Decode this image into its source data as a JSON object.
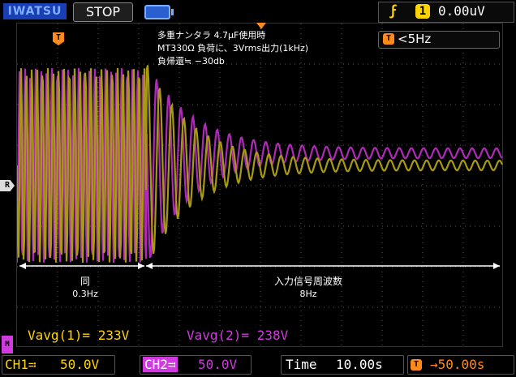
{
  "header": {
    "brand": "IWATSU",
    "run_state": "STOP",
    "trigger_edge_icon": "rising-edge-icon",
    "trigger_channel": "1",
    "trigger_level": "0.00uV"
  },
  "screen": {
    "trigger_marker": "T",
    "reference_marker": "R",
    "ch2_marker": "M",
    "freq_counter_icon": "T",
    "freq_counter": "<5Hz",
    "annotation": {
      "line1": "多重ナンタラ 4.7μF使用時",
      "line2": "MT330Ω 負荷に、3Vrms出力(1kHz)",
      "line3": "負帰還≒ −30db"
    },
    "span_left": {
      "label": "同",
      "value": "0.3Hz"
    },
    "span_right": {
      "label": "入力信号周波数",
      "value": "8Hz"
    },
    "measure_ch1": "Vavg(1)= 233V",
    "measure_ch2": "Vavg(2)= 238V"
  },
  "bottom": {
    "ch1_label": "CH1≕",
    "ch1_scale": "50.0V",
    "ch2_label": "CH2≕",
    "ch2_scale": "50.0V",
    "time_label": "Time",
    "time_scale": "10.00s",
    "trigger_pos_icon": "T",
    "trigger_pos": "→50.00s"
  },
  "colors": {
    "ch1": "#a89a10",
    "ch2": "#b02ab8",
    "trigger": "#ff8a1c",
    "grid": "#5a5a5a"
  }
}
